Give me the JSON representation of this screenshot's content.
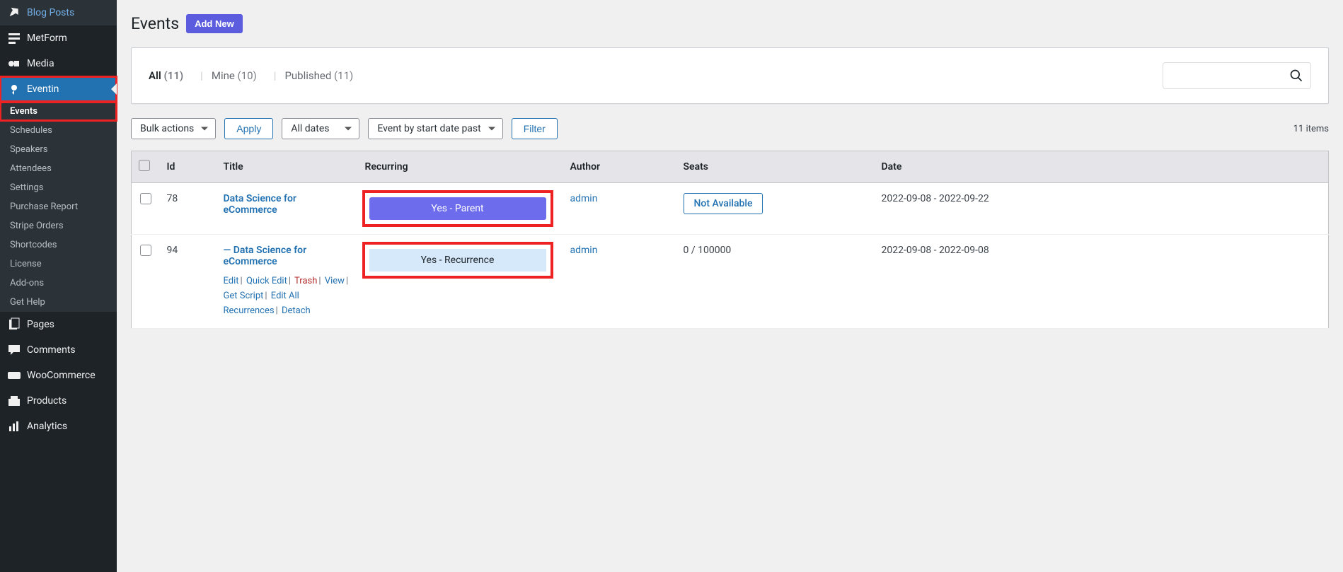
{
  "sidebar": {
    "top": [
      {
        "icon": "pin",
        "label": "Blog Posts"
      },
      {
        "icon": "form",
        "label": "MetForm"
      },
      {
        "icon": "media",
        "label": "Media"
      }
    ],
    "active": {
      "icon": "eventin",
      "label": "Eventin"
    },
    "submenu": [
      "Events",
      "Schedules",
      "Speakers",
      "Attendees",
      "Settings",
      "Purchase Report",
      "Stripe Orders",
      "Shortcodes",
      "License",
      "Add-ons",
      "Get Help"
    ],
    "bottom": [
      {
        "icon": "page",
        "label": "Pages"
      },
      {
        "icon": "comment",
        "label": "Comments"
      },
      {
        "icon": "woo",
        "label": "WooCommerce"
      },
      {
        "icon": "product",
        "label": "Products"
      },
      {
        "icon": "analytics",
        "label": "Analytics"
      }
    ]
  },
  "header": {
    "title": "Events",
    "add_new": "Add New"
  },
  "tabs": {
    "all_label": "All ",
    "all_count": "(11)",
    "mine_label": "Mine ",
    "mine_count": "(10)",
    "pub_label": "Published ",
    "pub_count": "(11)"
  },
  "filters": {
    "bulk": "Bulk actions",
    "apply": "Apply",
    "dates": "All dates",
    "event_past": "Event by start date past",
    "filter": "Filter",
    "items": "11 items"
  },
  "columns": {
    "id": "Id",
    "title": "Title",
    "recurring": "Recurring",
    "author": "Author",
    "seats": "Seats",
    "date": "Date"
  },
  "rows": [
    {
      "id": "78",
      "title": "Data Science for eCommerce",
      "badge": "Yes - Parent",
      "badge_type": "parent",
      "author": "admin",
      "seats": "Not Available",
      "seats_type": "pill",
      "date": "2022-09-08 - 2022-09-22"
    },
    {
      "id": "94",
      "title": "— Data Science for eCommerce",
      "badge": "Yes - Recurrence",
      "badge_type": "recur",
      "author": "admin",
      "seats": "0 / 100000",
      "seats_type": "text",
      "date": "2022-09-08 - 2022-09-08",
      "actions": {
        "edit": "Edit",
        "quick": "Quick Edit",
        "trash": "Trash",
        "view": "View",
        "getscript": "Get Script",
        "editall": "Edit All Recurrences",
        "detach": "Detach"
      }
    }
  ]
}
